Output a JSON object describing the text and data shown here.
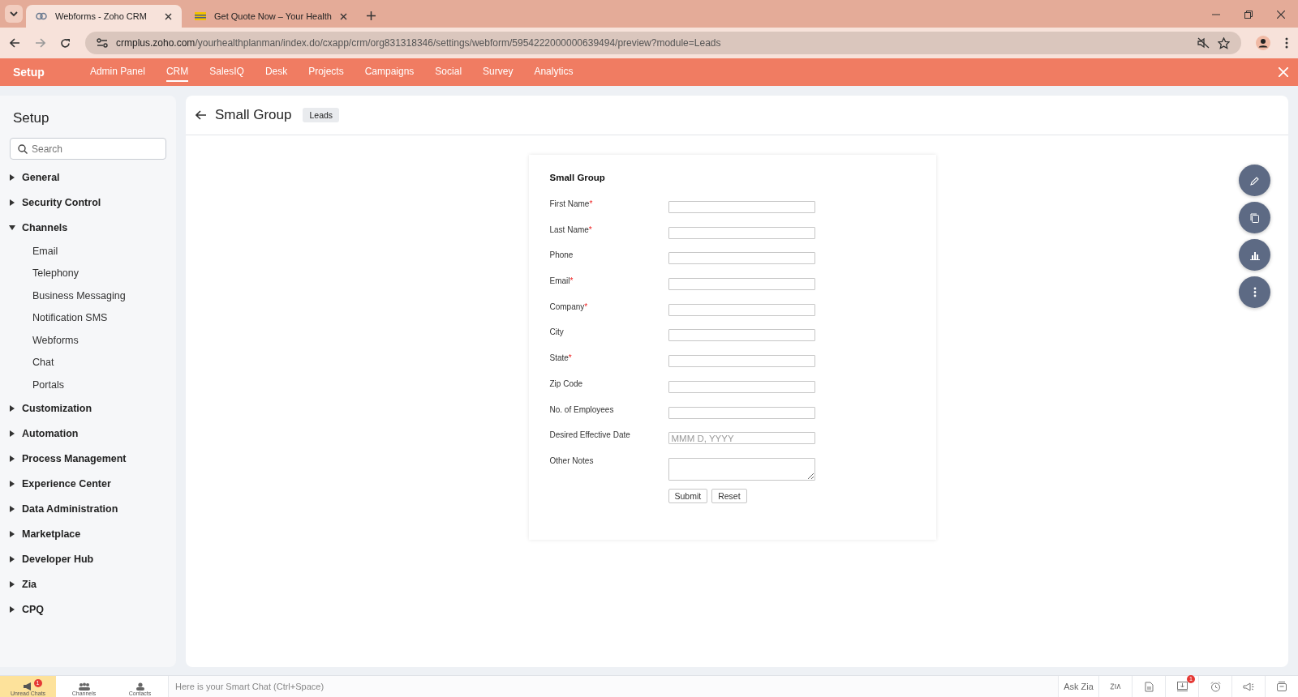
{
  "browser": {
    "tabs": [
      {
        "title": "Webforms - Zoho CRM",
        "selected": true,
        "kind": "link"
      },
      {
        "title": "Get Quote Now – Your Health",
        "selected": false,
        "kind": "flag"
      }
    ],
    "url_host": "crmplus.zoho.com",
    "url_path": "/yourhealthplanman/index.do/cxapp/crm/org831318346/settings/webform/5954222000000639494/preview?module=Leads"
  },
  "topnav": {
    "brand": "Setup",
    "items": [
      {
        "label": "Admin Panel",
        "selected": false
      },
      {
        "label": "CRM",
        "selected": true
      },
      {
        "label": "SalesIQ",
        "selected": false
      },
      {
        "label": "Desk",
        "selected": false
      },
      {
        "label": "Projects",
        "selected": false
      },
      {
        "label": "Campaigns",
        "selected": false
      },
      {
        "label": "Social",
        "selected": false
      },
      {
        "label": "Survey",
        "selected": false
      },
      {
        "label": "Analytics",
        "selected": false
      }
    ]
  },
  "sidebar": {
    "title": "Setup",
    "search_placeholder": "Search",
    "items": [
      {
        "label": "General",
        "expanded": false
      },
      {
        "label": "Security Control",
        "expanded": false
      },
      {
        "label": "Channels",
        "expanded": true,
        "children": [
          {
            "label": "Email"
          },
          {
            "label": "Telephony"
          },
          {
            "label": "Business Messaging"
          },
          {
            "label": "Notification SMS"
          },
          {
            "label": "Webforms"
          },
          {
            "label": "Chat"
          },
          {
            "label": "Portals"
          }
        ]
      },
      {
        "label": "Customization",
        "expanded": false
      },
      {
        "label": "Automation",
        "expanded": false
      },
      {
        "label": "Process Management",
        "expanded": false
      },
      {
        "label": "Experience Center",
        "expanded": false
      },
      {
        "label": "Data Administration",
        "expanded": false
      },
      {
        "label": "Marketplace",
        "expanded": false
      },
      {
        "label": "Developer Hub",
        "expanded": false
      },
      {
        "label": "Zia",
        "expanded": false
      },
      {
        "label": "CPQ",
        "expanded": false
      }
    ]
  },
  "page": {
    "title": "Small Group",
    "badge": "Leads"
  },
  "form": {
    "title": "Small Group",
    "fields": [
      {
        "label": "First Name",
        "required_mark": "*",
        "kind": "text"
      },
      {
        "label": "Last Name",
        "required_mark": "*",
        "kind": "text"
      },
      {
        "label": "Phone",
        "kind": "text"
      },
      {
        "label": "Email",
        "required_mark": "*",
        "kind": "text"
      },
      {
        "label": "Company",
        "required_mark": "*",
        "kind": "text"
      },
      {
        "label": "City",
        "kind": "text"
      },
      {
        "label": "State",
        "required_mark": "*",
        "kind": "text"
      },
      {
        "label": "Zip Code",
        "kind": "text"
      },
      {
        "label": "No. of Employees",
        "kind": "text"
      },
      {
        "label": "Desired Effective Date",
        "kind": "date",
        "placeholder": "MMM D, YYYY"
      },
      {
        "label": "Other Notes",
        "kind": "textarea"
      }
    ],
    "buttons": [
      "Submit",
      "Reset"
    ]
  },
  "actions": [
    {
      "kind": "edit"
    },
    {
      "kind": "copy"
    },
    {
      "kind": "chart"
    },
    {
      "kind": "more"
    }
  ],
  "bottombar": {
    "chat_items": [
      {
        "label": "Unread Chats",
        "badge": "1",
        "selected": true,
        "kind": "chats"
      },
      {
        "label": "Channels",
        "selected": false,
        "kind": "channels"
      },
      {
        "label": "Contacts",
        "selected": false,
        "kind": "contacts"
      }
    ],
    "smart_chat_placeholder": "Here is your Smart Chat (Ctrl+Space)",
    "ask_zia": "Ask Zia",
    "tools": [
      {
        "kind": "zia"
      },
      {
        "kind": "document"
      },
      {
        "kind": "download",
        "badge": "1"
      },
      {
        "kind": "alarm"
      },
      {
        "kind": "announce"
      },
      {
        "kind": "tray"
      }
    ]
  }
}
